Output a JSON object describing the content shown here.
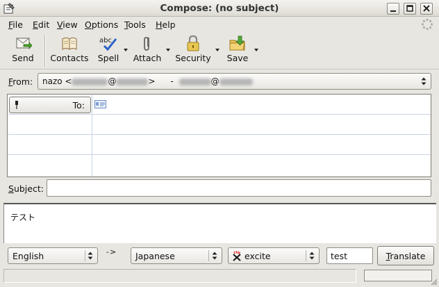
{
  "window": {
    "title": "Compose: (no subject)"
  },
  "menu": [
    {
      "pre": "",
      "key": "F",
      "post": "ile"
    },
    {
      "pre": "",
      "key": "E",
      "post": "dit"
    },
    {
      "pre": "",
      "key": "V",
      "post": "iew"
    },
    {
      "pre": "",
      "key": "O",
      "post": "ptions"
    },
    {
      "pre": "",
      "key": "T",
      "post": "ools"
    },
    {
      "pre": "",
      "key": "H",
      "post": "elp"
    }
  ],
  "toolbar": {
    "send": "Send",
    "contacts": "Contacts",
    "spell": "Spell",
    "spell_icon_text": "abc",
    "attach": "Attach",
    "security": "Security",
    "save": "Save"
  },
  "from": {
    "label_key": "F",
    "label_rest": "rom:",
    "name": "nazo <",
    "at": "@",
    "close": ">",
    "dash": "-"
  },
  "to": {
    "label": "To:"
  },
  "subject": {
    "label_key": "S",
    "label_rest": "ubject:",
    "value": ""
  },
  "body": {
    "text": "テスト"
  },
  "translate": {
    "source_lang": "English",
    "arrow": "->",
    "target_lang": "Japanese",
    "engine": "excite",
    "input": "test",
    "button_key": "T",
    "button_rest": "ranslate"
  }
}
